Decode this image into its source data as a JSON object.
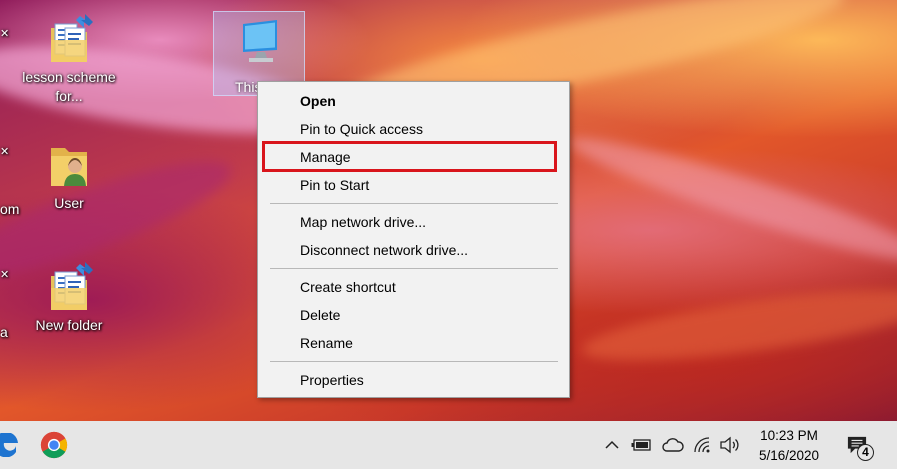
{
  "desktop": {
    "icons": [
      {
        "label": "lesson scheme for...",
        "icon": "shared-folder-icon"
      },
      {
        "label": "User",
        "icon": "user-folder-icon"
      },
      {
        "label": "New folder",
        "icon": "shared-folder-icon"
      }
    ],
    "this_pc": {
      "label_visible": "This",
      "icon": "computer-icon"
    },
    "cut_labels": [
      "om",
      "a"
    ]
  },
  "context_menu": {
    "items": [
      {
        "label": "Open",
        "bold": true
      },
      {
        "label": "Pin to Quick access"
      },
      {
        "label": "Manage",
        "highlighted": true
      },
      {
        "label": "Pin to Start"
      },
      {
        "label": "Map network drive..."
      },
      {
        "label": "Disconnect network drive..."
      },
      {
        "label": "Create shortcut"
      },
      {
        "label": "Delete"
      },
      {
        "label": "Rename"
      },
      {
        "label": "Properties"
      }
    ],
    "highlight_color": "#d9151c"
  },
  "taskbar": {
    "pinned": [
      "edge-icon",
      "chrome-icon"
    ],
    "tray_icons": [
      "chevron-up-icon",
      "battery-icon",
      "onedrive-cloud-icon",
      "wifi-icon",
      "volume-icon"
    ],
    "clock": {
      "time": "10:23 PM",
      "date": "5/16/2020"
    },
    "notifications": {
      "icon": "action-center-icon",
      "count": "4"
    }
  },
  "colors": {
    "taskbar_bg": "#e6e6e6",
    "menu_bg": "#f2f2f2"
  }
}
